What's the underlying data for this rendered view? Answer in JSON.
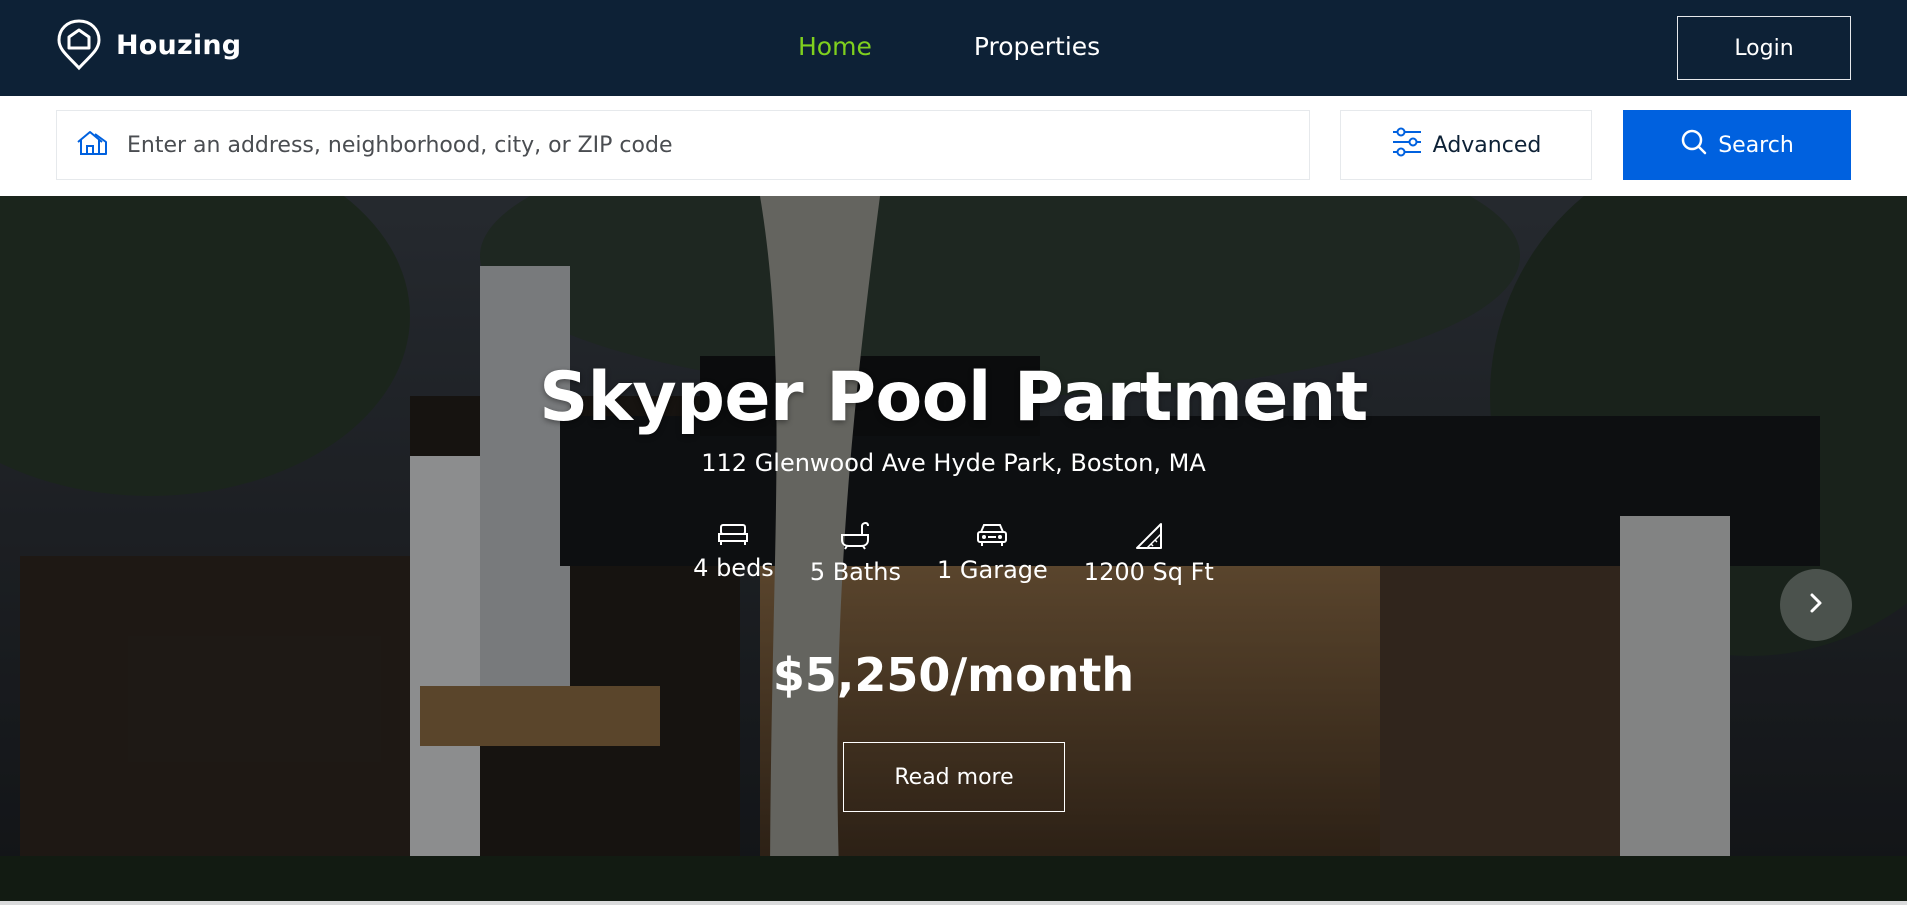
{
  "nav": {
    "logo_text": "Houzing",
    "links": [
      {
        "label": "Home",
        "active": true
      },
      {
        "label": "Properties",
        "active": false
      }
    ],
    "login_label": "Login"
  },
  "search": {
    "placeholder": "Enter an address, neighborhood, city, or ZIP code",
    "value": "",
    "advanced_label": "Advanced",
    "search_label": "Search"
  },
  "hero": {
    "title": "Skyper Pool Partment",
    "address": "112 Glenwood Ave Hyde Park, Boston, MA",
    "features": [
      {
        "icon": "bed-icon",
        "label": "4 beds"
      },
      {
        "icon": "bath-icon",
        "label": "5 Baths"
      },
      {
        "icon": "garage-icon",
        "label": "1 Garage"
      },
      {
        "icon": "ruler-icon",
        "label": "1200 Sq Ft"
      }
    ],
    "price": "$5,250/month",
    "read_more_label": "Read more"
  },
  "colors": {
    "nav_bg": "#0d2136",
    "accent_active": "#7fd01e",
    "primary_button": "#0061df"
  }
}
